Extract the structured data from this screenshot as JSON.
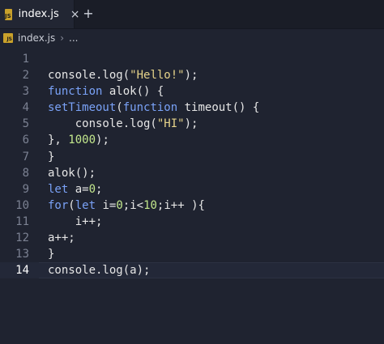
{
  "tab": {
    "badge": "JS",
    "title": "index.js",
    "close_glyph": "×"
  },
  "new_tab_glyph": "+",
  "breadcrumb": {
    "badge": "JS",
    "file": "index.js",
    "separator": "›",
    "more": "..."
  },
  "colors": {
    "keyword": "#7aa2f7",
    "string": "#e6d38a",
    "number": "#c3e88d",
    "background": "#1f2330",
    "js_badge": "#c9a12b"
  },
  "editor": {
    "current_line": 14,
    "lines": [
      [],
      [
        [
          "id",
          "console.log("
        ],
        [
          "str",
          "\"Hello!\""
        ],
        [
          "id",
          ");"
        ]
      ],
      [
        [
          "kw",
          "function"
        ],
        [
          "id",
          " alok() {"
        ]
      ],
      [
        [
          "kw",
          "setTimeout"
        ],
        [
          "id",
          "("
        ],
        [
          "kw",
          "function"
        ],
        [
          "id",
          " timeout() {"
        ]
      ],
      [
        [
          "id",
          "    console.log("
        ],
        [
          "str",
          "\"HI\""
        ],
        [
          "id",
          ");"
        ]
      ],
      [
        [
          "id",
          "}, "
        ],
        [
          "num",
          "1000"
        ],
        [
          "id",
          ");"
        ]
      ],
      [
        [
          "id",
          "}"
        ]
      ],
      [
        [
          "id",
          "alok();"
        ]
      ],
      [
        [
          "kw",
          "let"
        ],
        [
          "id",
          " a="
        ],
        [
          "num",
          "0"
        ],
        [
          "id",
          ";"
        ]
      ],
      [
        [
          "kw",
          "for"
        ],
        [
          "id",
          "("
        ],
        [
          "kw",
          "let"
        ],
        [
          "id",
          " i="
        ],
        [
          "num",
          "0"
        ],
        [
          "id",
          ";i<"
        ],
        [
          "num",
          "10"
        ],
        [
          "id",
          ";i++ ){"
        ]
      ],
      [
        [
          "id",
          "    i++;"
        ]
      ],
      [
        [
          "id",
          "a++;"
        ]
      ],
      [
        [
          "id",
          "}"
        ]
      ],
      [
        [
          "id",
          "console.log(a);"
        ]
      ]
    ]
  }
}
